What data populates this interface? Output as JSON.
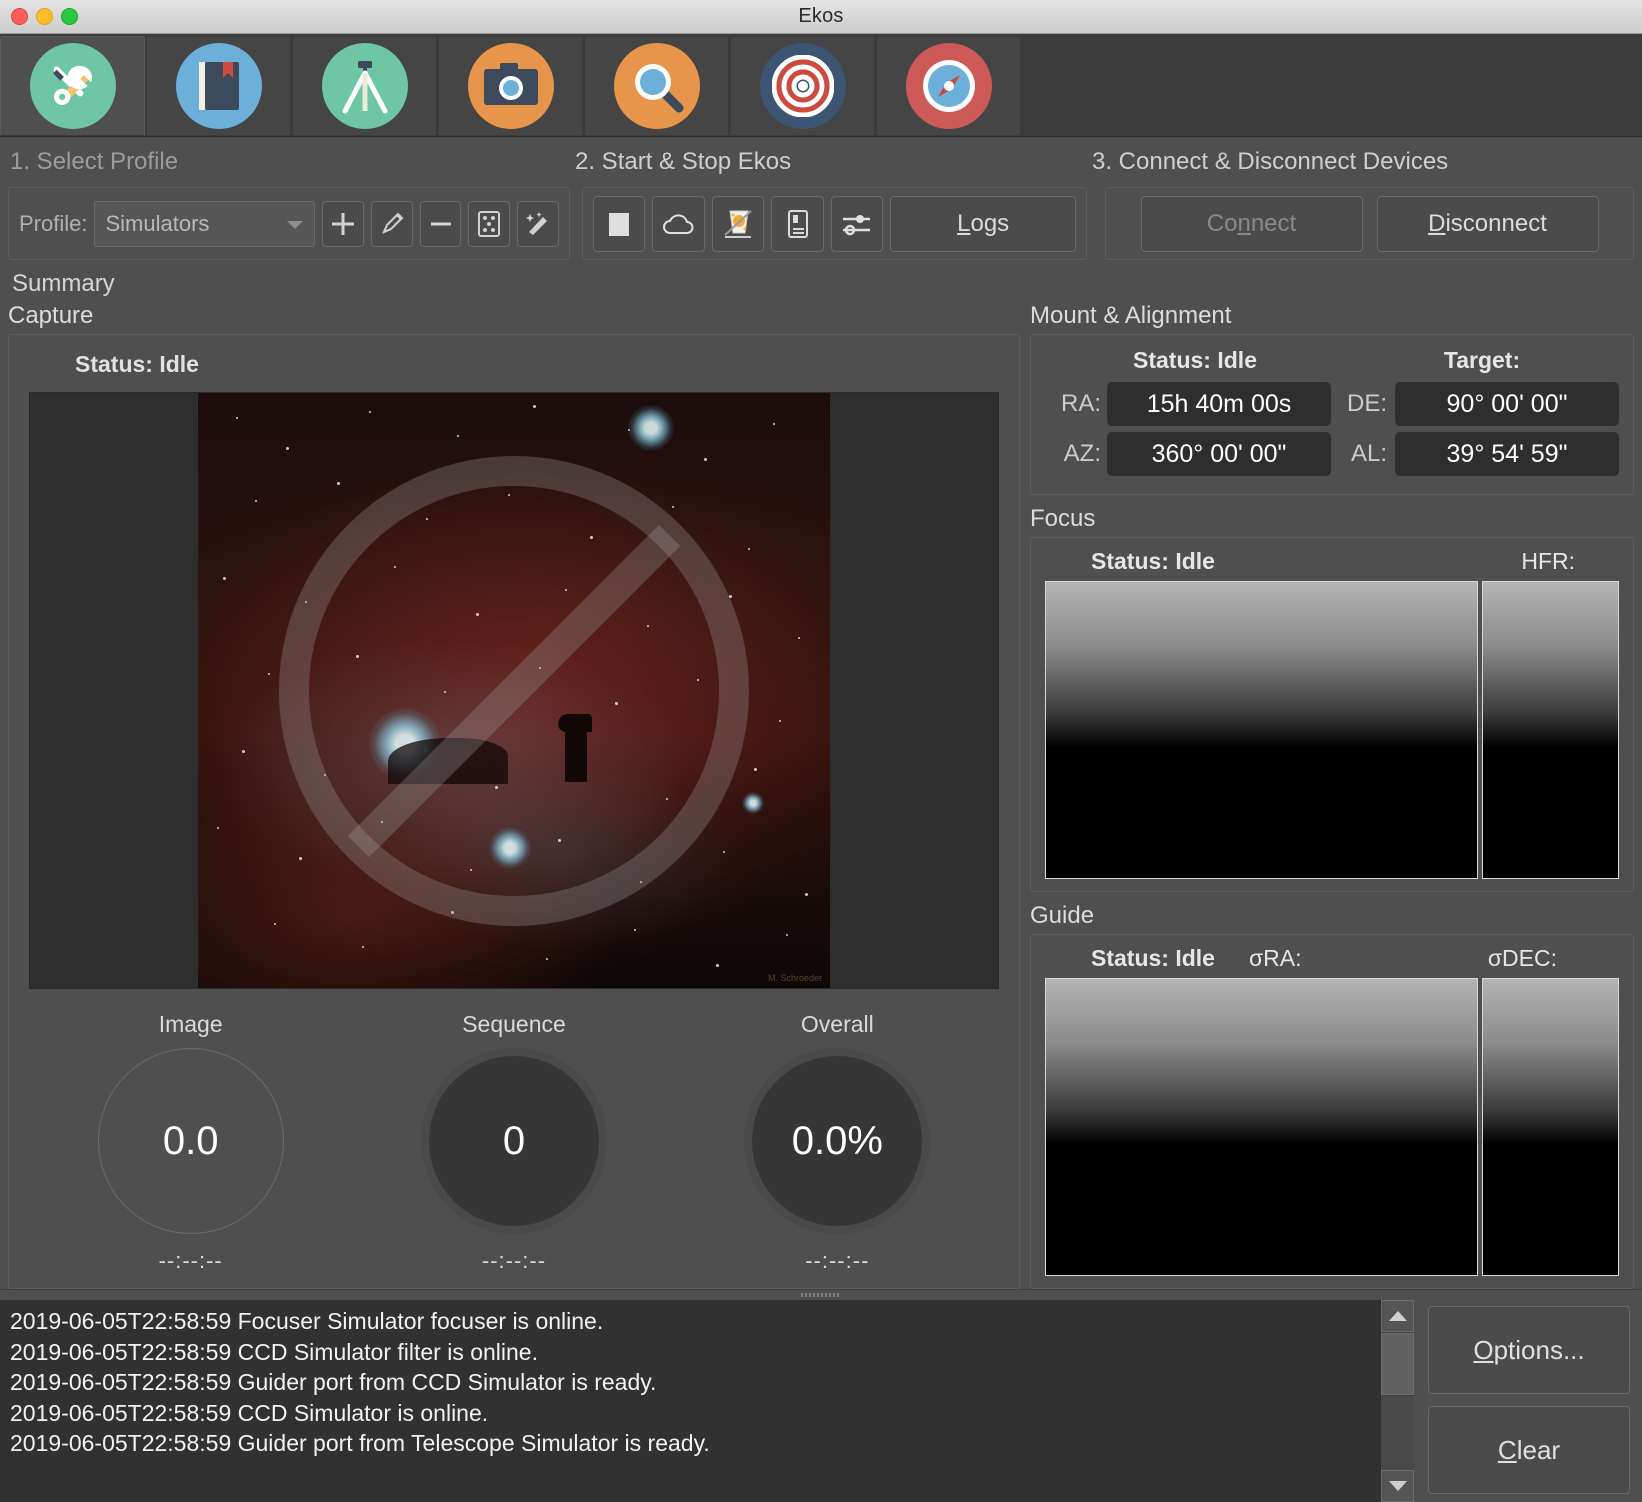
{
  "window": {
    "title": "Ekos"
  },
  "tabs": [
    {
      "name": "setup",
      "icon": "tools-icon",
      "active": true
    },
    {
      "name": "scheduler",
      "icon": "book-icon",
      "active": false
    },
    {
      "name": "mount",
      "icon": "tripod-icon",
      "active": false
    },
    {
      "name": "capture",
      "icon": "camera-icon",
      "active": false
    },
    {
      "name": "focus",
      "icon": "magnifier-icon",
      "active": false
    },
    {
      "name": "guide",
      "icon": "bullseye-icon",
      "active": false
    },
    {
      "name": "align",
      "icon": "compass-icon",
      "active": false
    }
  ],
  "steps": {
    "step1": "1. Select Profile",
    "step2": "2. Start & Stop Ekos",
    "step3": "3. Connect & Disconnect Devices"
  },
  "profile": {
    "label": "Profile:",
    "selected": "Simulators",
    "options": [
      "Simulators"
    ],
    "buttons": [
      {
        "name": "add-profile-button",
        "icon": "plus-icon"
      },
      {
        "name": "edit-profile-button",
        "icon": "pencil-icon"
      },
      {
        "name": "delete-profile-button",
        "icon": "minus-icon"
      },
      {
        "name": "custom-drivers-button",
        "icon": "dice-icon"
      },
      {
        "name": "wizard-button",
        "icon": "magic-wand-icon"
      }
    ]
  },
  "ekos_controls": {
    "buttons": [
      {
        "name": "stop-ekos-button",
        "icon": "stop-square-icon"
      },
      {
        "name": "cloud-button",
        "icon": "cloud-icon"
      },
      {
        "name": "ekoslive-button",
        "icon": "ekoslive-icon"
      },
      {
        "name": "indi-control-button",
        "icon": "indi-panel-icon"
      },
      {
        "name": "options-sliders-button",
        "icon": "sliders-icon"
      }
    ],
    "logs_label": "Logs",
    "logs_accel": "L"
  },
  "devices": {
    "connect_label": "Connect",
    "connect_accel": "n",
    "connect_enabled": false,
    "disconnect_label": "Disconnect",
    "disconnect_accel": "D"
  },
  "summary": {
    "label": "Summary",
    "capture": {
      "title": "Capture",
      "status_label": "Status:",
      "status_value": "Idle",
      "preview_alt": "Horsehead Nebula preview (disabled)",
      "progress": [
        {
          "name": "Image",
          "value": "0.0",
          "time": "--:--:--"
        },
        {
          "name": "Sequence",
          "value": "0",
          "time": "--:--:--"
        },
        {
          "name": "Overall",
          "value": "0.0%",
          "time": "--:--:--"
        }
      ]
    },
    "mount": {
      "title": "Mount & Alignment",
      "status_label": "Status:",
      "status_value": "Idle",
      "target_label": "Target:",
      "ra_label": "RA:",
      "ra_value": "15h 40m 00s",
      "de_label": "DE:",
      "de_value": "90° 00' 00\"",
      "az_label": "AZ:",
      "az_value": "360° 00' 00\"",
      "al_label": "AL:",
      "al_value": "39° 54' 59\""
    },
    "focus": {
      "title": "Focus",
      "status_label": "Status:",
      "status_value": "Idle",
      "hfr_label": "HFR:"
    },
    "guide": {
      "title": "Guide",
      "status_label": "Status:",
      "status_value": "Idle",
      "sigma_ra_label": "σRA:",
      "sigma_dec_label": "σDEC:"
    }
  },
  "log": {
    "lines": [
      "2019-06-05T22:58:59 Focuser Simulator focuser is online.",
      "2019-06-05T22:58:59 CCD Simulator filter is online.",
      "2019-06-05T22:58:59 Guider port from CCD Simulator is ready.",
      "2019-06-05T22:58:59 CCD Simulator is online.",
      "2019-06-05T22:58:59 Guider port from Telescope Simulator is ready."
    ],
    "options_label": "Options...",
    "options_accel": "O",
    "clear_label": "Clear",
    "clear_accel": "C"
  },
  "colors": {
    "window_bg": "#4f4f4f",
    "titlebar": "#d8d8d8",
    "accent_green": "#6ec6a4",
    "accent_blue": "#6cafd9",
    "accent_orange": "#e8954c",
    "accent_navy": "#3b5573",
    "accent_red": "#ce5a58",
    "log_bg": "#313131",
    "coord_bg": "#2e2e2e"
  }
}
